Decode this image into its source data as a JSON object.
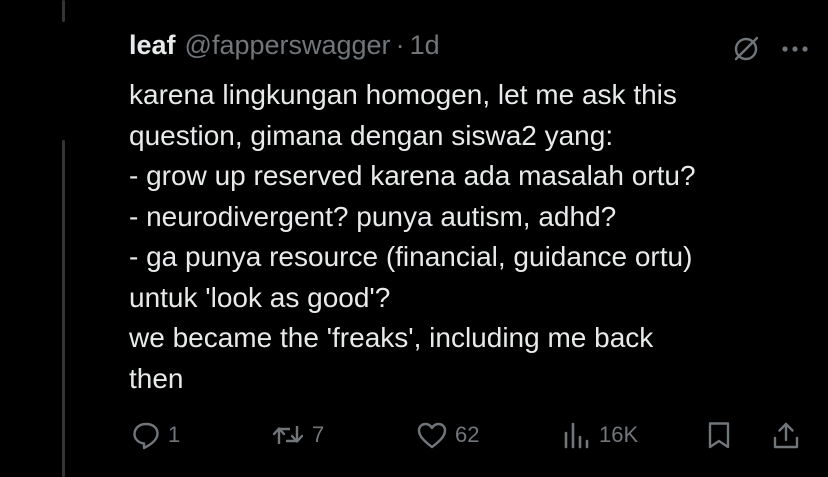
{
  "tweet": {
    "display_name": "leaf",
    "handle": "@fapperswagger",
    "separator": "·",
    "time": "1d",
    "lines": [
      "karena lingkungan homogen, let me ask this",
      "question, gimana dengan siswa2 yang:",
      "- grow up reserved karena ada masalah ortu?",
      "- neurodivergent? punya autism, adhd?",
      "- ga punya resource (financial, guidance ortu)",
      "untuk 'look as good'?",
      "we became the 'freaks', including me back",
      "then"
    ]
  },
  "actions": {
    "replies": "1",
    "reposts": "7",
    "likes": "62",
    "views": "16K"
  },
  "icons": {
    "header": [
      "grok-icon",
      "more-icon"
    ],
    "actions": [
      "reply-icon",
      "repost-icon",
      "like-icon",
      "views-icon",
      "bookmark-icon",
      "share-icon"
    ]
  },
  "colors": {
    "background": "#000000",
    "text": "#e7e9ea",
    "secondary": "#71767b",
    "thread_line": "#333639"
  }
}
